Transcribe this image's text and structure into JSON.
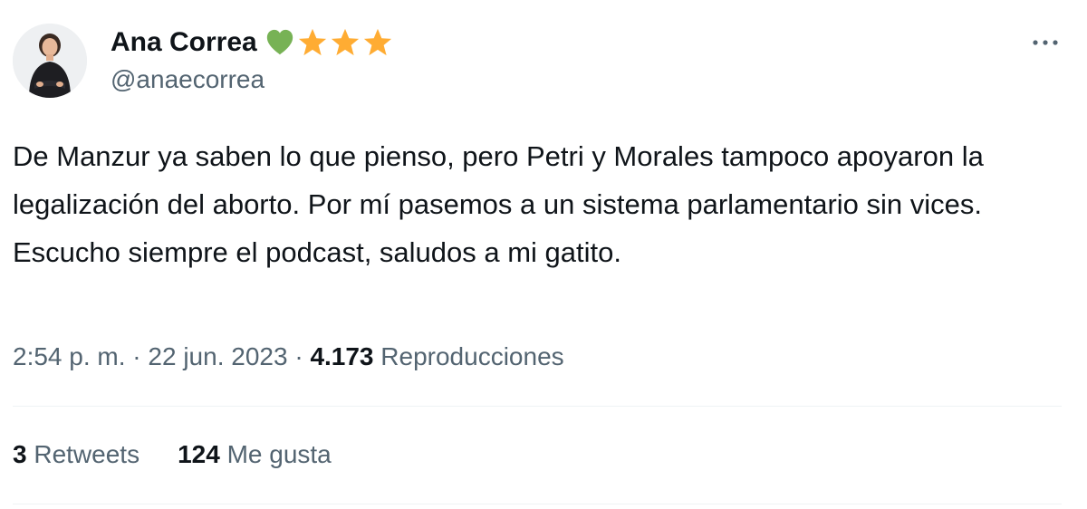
{
  "tweet": {
    "author": {
      "display_name": "Ana Correa",
      "handle": "@anaecorrea",
      "badges": [
        "green-heart-icon",
        "star-icon",
        "star-icon",
        "star-icon"
      ]
    },
    "text": "De Manzur ya saben lo que pienso, pero Petri y Morales tampoco apoyaron la legalización del aborto. Por mí pasemos a un sistema parlamentario sin vices. Escucho siempre el podcast, saludos a mi gatito.",
    "time": "2:54 p. m.",
    "separator": "·",
    "date": "22 jun. 2023",
    "views_count": "4.173",
    "views_label": "Reproducciones",
    "retweets_count": "3",
    "retweets_label": "Retweets",
    "likes_count": "124",
    "likes_label": "Me gusta"
  },
  "colors": {
    "text_primary": "#0f1419",
    "text_secondary": "#536471",
    "divider": "#eff3f4",
    "heart": "#77b255",
    "star": "#ffac33"
  },
  "icons": {
    "more": "more-icon"
  }
}
